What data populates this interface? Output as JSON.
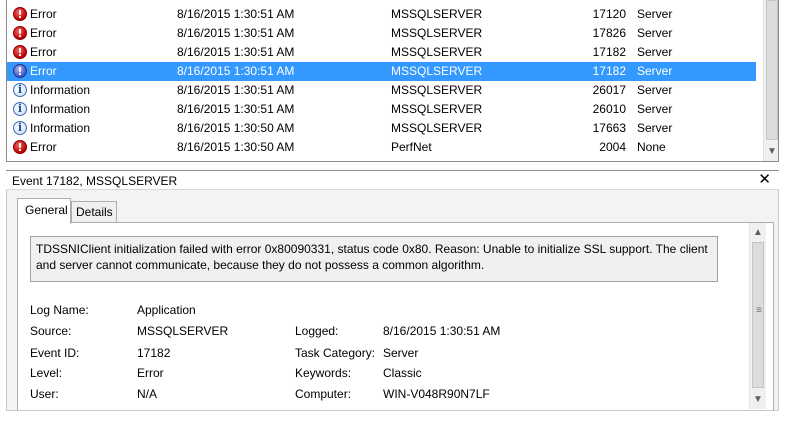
{
  "events": [
    {
      "level": "Error",
      "icon": "error-icon",
      "date": "8/16/2015 1:30:51 AM",
      "source": "MSSQLSERVER",
      "event_id": "17120",
      "category": "Server"
    },
    {
      "level": "Error",
      "icon": "error-icon",
      "date": "8/16/2015 1:30:51 AM",
      "source": "MSSQLSERVER",
      "event_id": "17826",
      "category": "Server"
    },
    {
      "level": "Error",
      "icon": "error-icon",
      "date": "8/16/2015 1:30:51 AM",
      "source": "MSSQLSERVER",
      "event_id": "17182",
      "category": "Server"
    },
    {
      "level": "Error",
      "icon": "error-icon",
      "date": "8/16/2015 1:30:51 AM",
      "source": "MSSQLSERVER",
      "event_id": "17182",
      "category": "Server"
    },
    {
      "level": "Information",
      "icon": "information-icon",
      "date": "8/16/2015 1:30:51 AM",
      "source": "MSSQLSERVER",
      "event_id": "26017",
      "category": "Server"
    },
    {
      "level": "Information",
      "icon": "information-icon",
      "date": "8/16/2015 1:30:51 AM",
      "source": "MSSQLSERVER",
      "event_id": "26010",
      "category": "Server"
    },
    {
      "level": "Information",
      "icon": "information-icon",
      "date": "8/16/2015 1:30:50 AM",
      "source": "MSSQLSERVER",
      "event_id": "17663",
      "category": "Server"
    },
    {
      "level": "Error",
      "icon": "error-icon",
      "date": "8/16/2015 1:30:50 AM",
      "source": "PerfNet",
      "event_id": "2004",
      "category": "None"
    }
  ],
  "selected_row": 3,
  "colors": {
    "selection": "#3399ff",
    "error": "#c00000",
    "info": "#1f4fa0"
  },
  "detail": {
    "title": "Event 17182, MSSQLSERVER",
    "close_glyph": "✕",
    "tabs": {
      "general": "General",
      "details": "Details"
    },
    "message": "TDSSNIClient initialization failed with error 0x80090331, status code 0x80. Reason: Unable to initialize SSL support. The client and server cannot communicate, because they do not possess a common algorithm.",
    "labels": {
      "log_name": "Log Name:",
      "source": "Source:",
      "event_id": "Event ID:",
      "level": "Level:",
      "user": "User:",
      "logged": "Logged:",
      "task_category": "Task Category:",
      "keywords": "Keywords:",
      "computer": "Computer:"
    },
    "values": {
      "log_name": "Application",
      "source": "MSSQLSERVER",
      "event_id": "17182",
      "level": "Error",
      "user": "N/A",
      "logged": "8/16/2015 1:30:51 AM",
      "task_category": "Server",
      "keywords": "Classic",
      "computer": "WIN-V048R90N7LF"
    }
  }
}
